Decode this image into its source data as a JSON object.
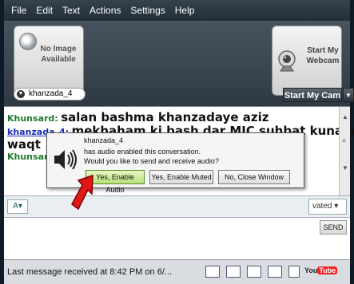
{
  "menu": [
    "File",
    "Edit",
    "Text",
    "Actions",
    "Settings",
    "Help"
  ],
  "video": {
    "left_label_line1": "No Image",
    "left_label_line2": "Available",
    "right_label_line1": "Start My",
    "right_label_line2": "Webcam",
    "username": "khanzada_4",
    "start_cam_label": "Start My Cam"
  },
  "chat": {
    "messages": [
      {
        "nick": "Khunsard:",
        "text": "salan bashma khanzadaye aziz"
      },
      {
        "nick": "khanzada_4:",
        "text": "mekhaham ki bash dar MIC suhbat kunam,"
      },
      {
        "nick": "",
        "text": "waqt"
      },
      {
        "nick": "Khunsar",
        "text": ""
      }
    ]
  },
  "toolbar": {
    "font_label": "A",
    "private_label": "vated"
  },
  "input": {
    "send_label": "SEND"
  },
  "status": {
    "text": "Last message received at 8:42 PM on 6/...",
    "youtube_label": "You",
    "youtube_tube": "Tube"
  },
  "dialog": {
    "title": "khanzada_4",
    "line1": "has audio enabled this conversation.",
    "line2": "Would you like to send and receive audio?",
    "btn_enable": "Yes, Enable Audio",
    "btn_muted": "Yes, Enable Muted",
    "btn_close": "No, Close Window"
  },
  "colors": {
    "nick_green": "#1f7a2a",
    "nick_blue": "#1a2fb8",
    "arrow_red": "#e01818"
  }
}
